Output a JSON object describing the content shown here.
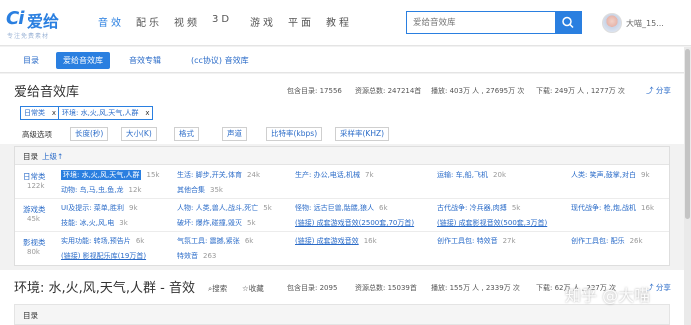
{
  "brand": {
    "name": "爱给",
    "mark": "Ci",
    "slogan": "专注免费素材",
    "color": "#2a7fe0"
  },
  "nav": [
    "音效",
    "配乐",
    "视频",
    "3D",
    "游戏",
    "平面",
    "教程"
  ],
  "nav_active_index": 0,
  "search": {
    "placeholder": "爱给音效库",
    "icon": "search-icon"
  },
  "user": {
    "name": "大喵_15..."
  },
  "tabs": [
    "目录",
    "爱给音效库",
    "音效专辑",
    "(cc协议) 音效库"
  ],
  "tabs_active_index": 1,
  "library": {
    "title": "爱给音效库",
    "stats": {
      "dirs": "包含目录: 17556",
      "resources": "资源总数: 247214首",
      "plays": "播放: 403万 人 , 27695万 次",
      "downloads": "下载: 249万 人 , 1277万 次"
    },
    "share": "分享"
  },
  "filters": [
    {
      "label": "日常类"
    },
    {
      "label": "环境: 水,火,风,天气,人群"
    }
  ],
  "filter_remove": "x",
  "advanced": {
    "label": "高级选项",
    "options": [
      "长度(秒)",
      "大小(K)",
      "格式",
      "声道",
      "比特率(kbps)",
      "采样率(KHZ)"
    ]
  },
  "directory": {
    "title": "目录",
    "up": "上级↑",
    "categories": [
      {
        "name": "日常类",
        "count": "122k",
        "rows": [
          [
            {
              "label": "环境: 水,火,风,天气,人群",
              "n": "15k",
              "active": true
            },
            {
              "label": "生活: 脚步,开关,体育",
              "n": "24k"
            },
            {
              "label": "生产: 办公,电话,机械",
              "n": "7k"
            },
            {
              "label": "运输: 车,船,飞机",
              "n": "20k"
            },
            {
              "label": "人类: 笑声,鼓掌,对白",
              "n": "9k"
            }
          ],
          [
            {
              "label": "动物: 鸟,马,虫,鱼,龙",
              "n": "12k"
            },
            {
              "label": "其他合集",
              "n": "35k"
            }
          ]
        ]
      },
      {
        "name": "游戏类",
        "count": "45k",
        "rows": [
          [
            {
              "label": "UI及提示: 菜单,胜利",
              "n": "9k"
            },
            {
              "label": "人物: 人类,兽人,战斗,死亡",
              "n": "5k"
            },
            {
              "label": "怪物: 远古巨兽,骷髅,狼人",
              "n": "6k"
            },
            {
              "label": "古代战争: 冷兵器,肉搏",
              "n": "5k"
            },
            {
              "label": "现代战争: 枪,炮,战机",
              "n": "16k"
            }
          ],
          [
            {
              "label": "技能: 冰,火,风,电",
              "n": "3k"
            },
            {
              "label": "破坏: 爆炸,碰撞,毁灭",
              "n": "5k"
            },
            {
              "label": "(链接) 成套游戏音效(2500套,70万首)",
              "n": ""
            },
            {
              "label": "(链接) 成套影视音效(500套,3万首)",
              "n": ""
            }
          ]
        ]
      },
      {
        "name": "影视类",
        "count": "80k",
        "rows": [
          [
            {
              "label": "实用功能: 转场,预告片",
              "n": "6k"
            },
            {
              "label": "气氛工具: 震撼,紧张",
              "n": "6k"
            },
            {
              "label": "(链接) 成套游戏音效",
              "n": "16k"
            },
            {
              "label": "创作工具包: 特效音",
              "n": "27k"
            },
            {
              "label": "创作工具包: 配乐",
              "n": "26k"
            }
          ],
          [
            {
              "label": "(链接) 影视配乐库(19万首)",
              "n": ""
            },
            {
              "label": "特效音",
              "n": "263"
            }
          ]
        ]
      }
    ]
  },
  "section": {
    "title": "环境: 水,火,风,天气,人群 - 音效",
    "search": "搜索",
    "favorite": "收藏",
    "stats": {
      "dirs": "包含目录: 2095",
      "resources": "资源总数: 15039首",
      "plays": "播放: 155万 人 , 2339万 次",
      "downloads": "下载: 62万 人 , 227万 次"
    },
    "share": "分享",
    "dir_label": "目录"
  },
  "watermark": "知乎 @大喵"
}
